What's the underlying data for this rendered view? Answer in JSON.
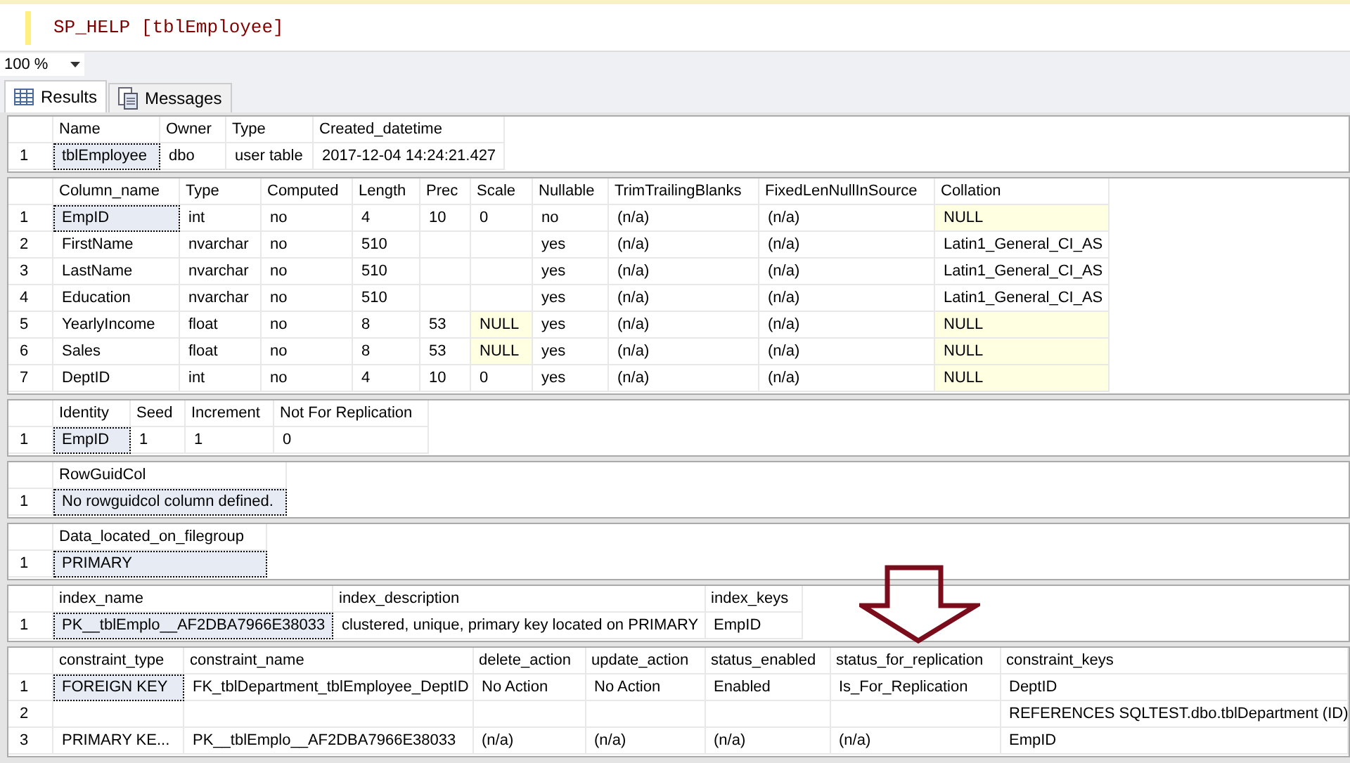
{
  "editor": {
    "query": "SP_HELP [tblEmployee]"
  },
  "zoom": {
    "value": "100 %"
  },
  "tabs": [
    {
      "label": "Results",
      "selected": true,
      "kind": "grid"
    },
    {
      "label": "Messages",
      "selected": false,
      "kind": "messages"
    }
  ],
  "grids": [
    {
      "columns": [
        {
          "label": "Name"
        },
        {
          "label": "Owner"
        },
        {
          "label": "Type"
        },
        {
          "label": "Created_datetime"
        }
      ],
      "rows": [
        {
          "number": "1",
          "cells": [
            {
              "text": "tblEmployee",
              "selected": true,
              "null": false
            },
            {
              "text": "dbo",
              "selected": false,
              "null": false
            },
            {
              "text": "user table",
              "selected": false,
              "null": false
            },
            {
              "text": "2017-12-04 14:24:21.427",
              "selected": false,
              "null": false
            }
          ]
        }
      ]
    },
    {
      "columns": [
        {
          "label": "Column_name"
        },
        {
          "label": "Type"
        },
        {
          "label": "Computed"
        },
        {
          "label": "Length"
        },
        {
          "label": "Prec"
        },
        {
          "label": "Scale"
        },
        {
          "label": "Nullable"
        },
        {
          "label": "TrimTrailingBlanks"
        },
        {
          "label": "FixedLenNullInSource"
        },
        {
          "label": "Collation"
        }
      ],
      "rows": [
        {
          "number": "1",
          "cells": [
            {
              "text": "EmpID",
              "selected": true,
              "null": false
            },
            {
              "text": "int",
              "selected": false,
              "null": false
            },
            {
              "text": "no",
              "selected": false,
              "null": false
            },
            {
              "text": "4",
              "selected": false,
              "null": false
            },
            {
              "text": "10",
              "selected": false,
              "null": false
            },
            {
              "text": "0",
              "selected": false,
              "null": false
            },
            {
              "text": "no",
              "selected": false,
              "null": false
            },
            {
              "text": "(n/a)",
              "selected": false,
              "null": false
            },
            {
              "text": "(n/a)",
              "selected": false,
              "null": false
            },
            {
              "text": "NULL",
              "selected": false,
              "null": true
            }
          ]
        },
        {
          "number": "2",
          "cells": [
            {
              "text": "FirstName",
              "selected": false,
              "null": false
            },
            {
              "text": "nvarchar",
              "selected": false,
              "null": false
            },
            {
              "text": "no",
              "selected": false,
              "null": false
            },
            {
              "text": "510",
              "selected": false,
              "null": false
            },
            {
              "selected": false,
              "null": false
            },
            {
              "selected": false,
              "null": false
            },
            {
              "text": "yes",
              "selected": false,
              "null": false
            },
            {
              "text": "(n/a)",
              "selected": false,
              "null": false
            },
            {
              "text": "(n/a)",
              "selected": false,
              "null": false
            },
            {
              "text": "Latin1_General_CI_AS",
              "selected": false,
              "null": false
            }
          ]
        },
        {
          "number": "3",
          "cells": [
            {
              "text": "LastName",
              "selected": false,
              "null": false
            },
            {
              "text": "nvarchar",
              "selected": false,
              "null": false
            },
            {
              "text": "no",
              "selected": false,
              "null": false
            },
            {
              "text": "510",
              "selected": false,
              "null": false
            },
            {
              "selected": false,
              "null": false
            },
            {
              "selected": false,
              "null": false
            },
            {
              "text": "yes",
              "selected": false,
              "null": false
            },
            {
              "text": "(n/a)",
              "selected": false,
              "null": false
            },
            {
              "text": "(n/a)",
              "selected": false,
              "null": false
            },
            {
              "text": "Latin1_General_CI_AS",
              "selected": false,
              "null": false
            }
          ]
        },
        {
          "number": "4",
          "cells": [
            {
              "text": "Education",
              "selected": false,
              "null": false
            },
            {
              "text": "nvarchar",
              "selected": false,
              "null": false
            },
            {
              "text": "no",
              "selected": false,
              "null": false
            },
            {
              "text": "510",
              "selected": false,
              "null": false
            },
            {
              "selected": false,
              "null": false
            },
            {
              "selected": false,
              "null": false
            },
            {
              "text": "yes",
              "selected": false,
              "null": false
            },
            {
              "text": "(n/a)",
              "selected": false,
              "null": false
            },
            {
              "text": "(n/a)",
              "selected": false,
              "null": false
            },
            {
              "text": "Latin1_General_CI_AS",
              "selected": false,
              "null": false
            }
          ]
        },
        {
          "number": "5",
          "cells": [
            {
              "text": "YearlyIncome",
              "selected": false,
              "null": false
            },
            {
              "text": "float",
              "selected": false,
              "null": false
            },
            {
              "text": "no",
              "selected": false,
              "null": false
            },
            {
              "text": "8",
              "selected": false,
              "null": false
            },
            {
              "text": "53",
              "selected": false,
              "null": false
            },
            {
              "text": "NULL",
              "selected": false,
              "null": true
            },
            {
              "text": "yes",
              "selected": false,
              "null": false
            },
            {
              "text": "(n/a)",
              "selected": false,
              "null": false
            },
            {
              "text": "(n/a)",
              "selected": false,
              "null": false
            },
            {
              "text": "NULL",
              "selected": false,
              "null": true
            }
          ]
        },
        {
          "number": "6",
          "cells": [
            {
              "text": "Sales",
              "selected": false,
              "null": false
            },
            {
              "text": "float",
              "selected": false,
              "null": false
            },
            {
              "text": "no",
              "selected": false,
              "null": false
            },
            {
              "text": "8",
              "selected": false,
              "null": false
            },
            {
              "text": "53",
              "selected": false,
              "null": false
            },
            {
              "text": "NULL",
              "selected": false,
              "null": true
            },
            {
              "text": "yes",
              "selected": false,
              "null": false
            },
            {
              "text": "(n/a)",
              "selected": false,
              "null": false
            },
            {
              "text": "(n/a)",
              "selected": false,
              "null": false
            },
            {
              "text": "NULL",
              "selected": false,
              "null": true
            }
          ]
        },
        {
          "number": "7",
          "cells": [
            {
              "text": "DeptID",
              "selected": false,
              "null": false
            },
            {
              "text": "int",
              "selected": false,
              "null": false
            },
            {
              "text": "no",
              "selected": false,
              "null": false
            },
            {
              "text": "4",
              "selected": false,
              "null": false
            },
            {
              "text": "10",
              "selected": false,
              "null": false
            },
            {
              "text": "0",
              "selected": false,
              "null": false
            },
            {
              "text": "yes",
              "selected": false,
              "null": false
            },
            {
              "text": "(n/a)",
              "selected": false,
              "null": false
            },
            {
              "text": "(n/a)",
              "selected": false,
              "null": false
            },
            {
              "text": "NULL",
              "selected": false,
              "null": true
            }
          ]
        }
      ]
    },
    {
      "columns": [
        {
          "label": "Identity"
        },
        {
          "label": "Seed"
        },
        {
          "label": "Increment"
        },
        {
          "label": "Not For Replication"
        }
      ],
      "rows": [
        {
          "number": "1",
          "cells": [
            {
              "text": "EmpID",
              "selected": true,
              "null": false
            },
            {
              "text": "1",
              "selected": false,
              "null": false
            },
            {
              "text": "1",
              "selected": false,
              "null": false
            },
            {
              "text": "0",
              "selected": false,
              "null": false
            }
          ]
        }
      ]
    },
    {
      "columns": [
        {
          "label": "RowGuidCol"
        }
      ],
      "rows": [
        {
          "number": "1",
          "cells": [
            {
              "text": "No rowguidcol column defined.",
              "selected": true,
              "null": false
            }
          ]
        }
      ]
    },
    {
      "columns": [
        {
          "label": "Data_located_on_filegroup"
        }
      ],
      "rows": [
        {
          "number": "1",
          "cells": [
            {
              "text": "PRIMARY",
              "selected": true,
              "null": false
            }
          ]
        }
      ]
    },
    {
      "columns": [
        {
          "label": "index_name"
        },
        {
          "label": "index_description"
        },
        {
          "label": "index_keys"
        }
      ],
      "rows": [
        {
          "number": "1",
          "cells": [
            {
              "text": "PK__tblEmplo__AF2DBA7966E38033",
              "selected": true,
              "null": false
            },
            {
              "text": "clustered, unique, primary key located on PRIMARY",
              "selected": false,
              "null": false
            },
            {
              "text": "EmpID",
              "selected": false,
              "null": false
            }
          ]
        }
      ]
    },
    {
      "columns": [
        {
          "label": "constraint_type"
        },
        {
          "label": "constraint_name"
        },
        {
          "label": "delete_action"
        },
        {
          "label": "update_action"
        },
        {
          "label": "status_enabled"
        },
        {
          "label": "status_for_replication"
        },
        {
          "label": "constraint_keys"
        }
      ],
      "rows": [
        {
          "number": "1",
          "cells": [
            {
              "text": "FOREIGN KEY",
              "selected": true,
              "null": false
            },
            {
              "text": "FK_tblDepartment_tblEmployee_DeptID",
              "selected": false,
              "null": false
            },
            {
              "text": "No Action",
              "selected": false,
              "null": false
            },
            {
              "text": "No Action",
              "selected": false,
              "null": false
            },
            {
              "text": "Enabled",
              "selected": false,
              "null": false
            },
            {
              "text": "Is_For_Replication",
              "selected": false,
              "null": false
            },
            {
              "text": "DeptID",
              "selected": false,
              "null": false
            }
          ]
        },
        {
          "number": "2",
          "cells": [
            {
              "selected": false,
              "null": false
            },
            {
              "selected": false,
              "null": false
            },
            {
              "selected": false,
              "null": false
            },
            {
              "selected": false,
              "null": false
            },
            {
              "selected": false,
              "null": false
            },
            {
              "selected": false,
              "null": false
            },
            {
              "text": "REFERENCES SQLTEST.dbo.tblDepartment (ID)",
              "selected": false,
              "null": false
            }
          ]
        },
        {
          "number": "3",
          "cells": [
            {
              "text": "PRIMARY KE...",
              "selected": false,
              "null": false
            },
            {
              "text": "PK__tblEmplo__AF2DBA7966E38033",
              "selected": false,
              "null": false
            },
            {
              "text": "(n/a)",
              "selected": false,
              "null": false
            },
            {
              "text": "(n/a)",
              "selected": false,
              "null": false
            },
            {
              "text": "(n/a)",
              "selected": false,
              "null": false
            },
            {
              "text": "(n/a)",
              "selected": false,
              "null": false
            },
            {
              "text": "EmpID",
              "selected": false,
              "null": false
            }
          ]
        }
      ]
    }
  ]
}
